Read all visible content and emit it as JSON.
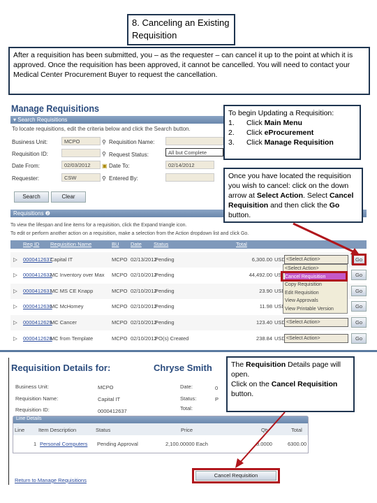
{
  "slide": {
    "title": "8. Canceling an Existing Requisition",
    "intro": "After a requisition has been submitted, you – as the requester – can cancel it up to the point at which it is approved.  Once the requisition has been approved, it cannot be cancelled.  You will need to contact your Medical Center Procurement Buyer to request the cancellation."
  },
  "callout1": {
    "heading": "To begin Updating a Requisition:",
    "steps": [
      {
        "n": "1.",
        "pre": "Click ",
        "bold": "Main Menu"
      },
      {
        "n": "2.",
        "pre": "Click ",
        "bold": "eProcurement"
      },
      {
        "n": "3.",
        "pre": "Click ",
        "bold": "Manage Requisition"
      }
    ]
  },
  "callout2": {
    "t1": "Once you have located the requisition you wish to cancel: click on the down arrow at ",
    "b1": "Select Action",
    "t2": ". Select ",
    "b2": "Cancel Requisition",
    "t3": " and then click the ",
    "b3": "Go",
    "t4": " button."
  },
  "callout3": {
    "t1": "The ",
    "b1": "Requisition",
    "t2": " Details page will open.",
    "t3": "Click on the ",
    "b2": "Cancel Requisition",
    "t4": " button."
  },
  "manage": {
    "title": "Manage Requisitions",
    "search_header": "Search Requisitions",
    "instructions": "To locate requisitions, edit the criteria below and click the Search button.",
    "fields": {
      "business_unit_label": "Business Unit:",
      "business_unit": "MCPO",
      "req_name_label": "Requisition Name:",
      "req_id_label": "Requisition ID:",
      "status_label": "Request Status:",
      "status": "All but Complete",
      "date_from_label": "Date From:",
      "date_from": "02/03/2012",
      "date_to_label": "Date To:",
      "date_to": "02/14/2012",
      "requester_label": "Requester:",
      "requester": "CSW",
      "entered_by_label": "Entered By:"
    },
    "search_button": "Search",
    "clear_button": "Clear",
    "req_header": "Requisitions",
    "req_instr1": "To view the lifespan and line items for a requisition, click the Expand triangle icon.",
    "req_instr2": "To edit or perform another action on a requisition, make a selection from the Action dropdown list and click Go.",
    "columns": [
      "Req ID",
      "Requisition Name",
      "BU",
      "Date",
      "Status",
      "Total"
    ],
    "rows": [
      {
        "id": "0000412637",
        "name": "Capital IT",
        "bu": "MCPO",
        "date": "02/13/2012",
        "status": "Pending",
        "total": "6,300.00",
        "cur": "USD",
        "action": "<Select Action>"
      },
      {
        "id": "0000412632",
        "name": "MC Inventory over Max",
        "bu": "MCPO",
        "date": "02/10/2012",
        "status": "Pending",
        "total": "44,492.00",
        "cur": "USD",
        "action": ""
      },
      {
        "id": "0000412631",
        "name": "MC MS CE Knapp",
        "bu": "MCPO",
        "date": "02/10/2012",
        "status": "Pending",
        "total": "23.90",
        "cur": "USD",
        "action": ""
      },
      {
        "id": "0000412630",
        "name": "MC McHomey",
        "bu": "MCPO",
        "date": "02/10/2012",
        "status": "Pending",
        "total": "11.98",
        "cur": "USD",
        "action": ""
      },
      {
        "id": "0000412629",
        "name": "MC Cancer",
        "bu": "MCPO",
        "date": "02/10/2012",
        "status": "Pending",
        "total": "123.40",
        "cur": "USD",
        "action": "<Select Action>"
      },
      {
        "id": "0000412628",
        "name": "MC from Template",
        "bu": "MCPO",
        "date": "02/10/2012",
        "status": "PO(s) Created",
        "total": "238.84",
        "cur": "USD",
        "action": "<Select Action>"
      }
    ],
    "go": "Go",
    "dropdown": [
      "<Select Action>",
      "Cancel Requisition",
      "Copy Requisition",
      "Edit Requisition",
      "View Approvals",
      "View Printable Version"
    ]
  },
  "details": {
    "title": "Requisition Details for:",
    "user": "Chryse Smith",
    "bu_label": "Business Unit:",
    "bu": "MCPO",
    "name_label": "Requisition Name:",
    "name": "Capital IT",
    "id_label": "Requisition ID:",
    "id": "0000412637",
    "date_label": "Date:",
    "status_label": "Status:",
    "total_label": "Total:",
    "date_partial": "0",
    "status_partial": "P",
    "line_header": "Line Details",
    "columns": [
      "Line",
      "Item Description",
      "Status",
      "Price",
      "Qty",
      "Total"
    ],
    "line": {
      "line": "1",
      "item": "Personal Computers",
      "status": "Pending Approval",
      "price": "2,100.00000 Each",
      "qty": "3.0000",
      "total": "6300.00"
    },
    "return_link": "Return to Manage Requisitions",
    "cancel_button": "Cancel Requisition"
  },
  "colors": {
    "accent": "#2b4c7e",
    "highlight": "#b0161c"
  }
}
